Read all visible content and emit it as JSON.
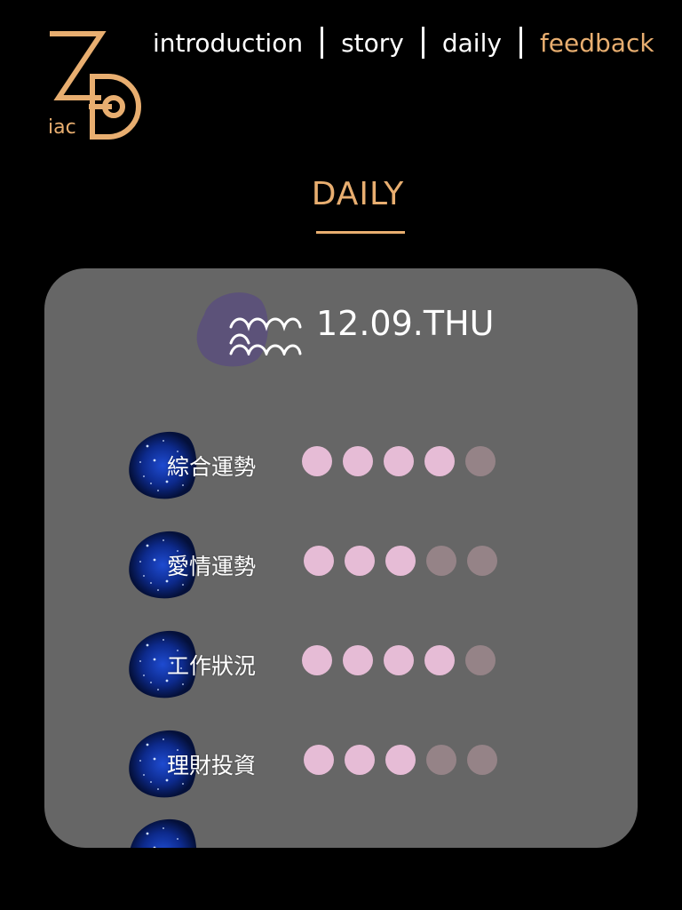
{
  "logo": {
    "letters": "ZD",
    "suffix": "iac",
    "color": "#e8ae70"
  },
  "nav": {
    "items": [
      {
        "label": "introduction",
        "active": false
      },
      {
        "label": "story",
        "active": false
      },
      {
        "label": "daily",
        "active": false
      },
      {
        "label": "feedback",
        "active": true
      }
    ]
  },
  "page_title": "DAILY",
  "card": {
    "sign_icon": "aquarius-icon",
    "date": "12.09.THU",
    "fortunes": [
      {
        "label": "綜合運勢",
        "rating": 4,
        "max": 5
      },
      {
        "label": "愛情運勢",
        "rating": 3,
        "max": 5
      },
      {
        "label": "工作狀況",
        "rating": 4,
        "max": 5
      },
      {
        "label": "理財投資",
        "rating": 3,
        "max": 5
      },
      {
        "label": "",
        "rating": 0,
        "max": 0
      }
    ]
  },
  "colors": {
    "accent": "#e8ae70",
    "card_bg": "#666666",
    "dot_on": "#e6bcd6",
    "dot_off": "#958387",
    "sign_blob": "#5c5279",
    "galaxy_blue": "#0d2a8c"
  }
}
